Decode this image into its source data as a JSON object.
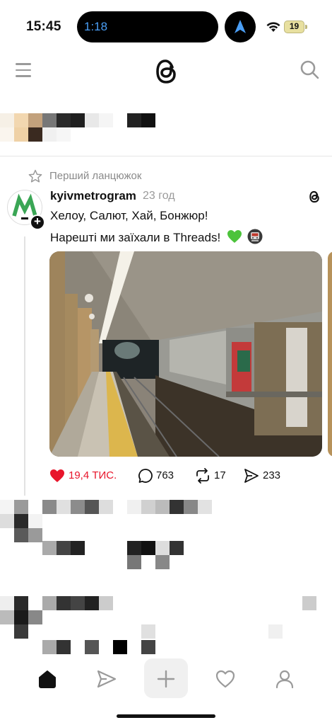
{
  "status_bar": {
    "time": "15:45",
    "timer": "1:18",
    "battery": "19"
  },
  "header": {
    "logo_icon": "threads-logo-icon",
    "menu_icon": "menu-icon",
    "search_icon": "search-icon"
  },
  "post": {
    "thread_label": "Перший ланцюжок",
    "username": "kyivmetrogram",
    "time": "23 год",
    "text_line1": "Хелоу, Салют, Хай, Бонжюр!",
    "text_line2": "Нарешті ми заїхали в Threads!",
    "image_description_icon": "metro-station-photo",
    "likes": "19,4 ТИС.",
    "comments": "763",
    "reposts": "17",
    "shares": "233",
    "like_color": "#e8152b"
  },
  "tabbar": {
    "items": [
      "home-icon",
      "send-icon",
      "compose-icon",
      "activity-icon",
      "profile-icon"
    ]
  }
}
